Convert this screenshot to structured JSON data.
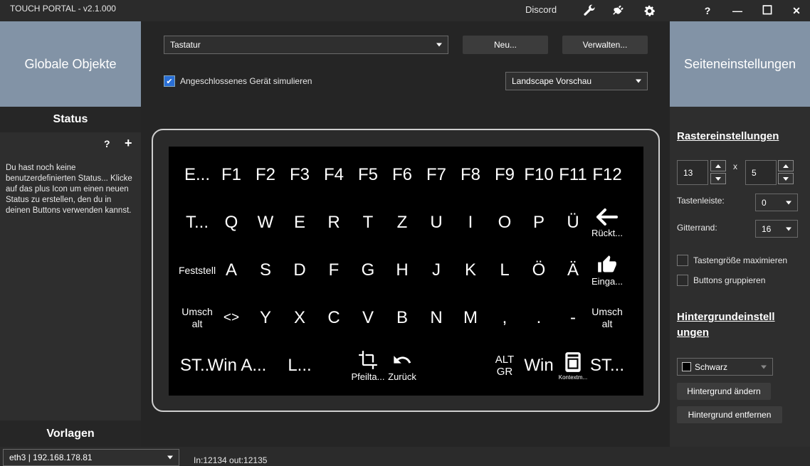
{
  "titlebar": {
    "app_title": "TOUCH PORTAL - v2.1.000",
    "profile": "Discord",
    "icons": [
      "wrench-icon",
      "plug-icon",
      "gear-icon"
    ],
    "help": "?",
    "minimize": "—",
    "maximize": "☐",
    "close": "✕"
  },
  "left": {
    "header": "Globale Objekte",
    "status_title": "Status",
    "status_help": "?",
    "status_add": "+",
    "status_text": "Du hast noch keine benutzerdefinierten Status... Klicke auf das plus Icon um einen neuen Status zu erstellen, den du in deinen Buttons verwenden kannst.",
    "templates_title": "Vorlagen"
  },
  "center": {
    "page_select": "Tastatur",
    "new_button": "Neu...",
    "manage_button": "Verwalten...",
    "simulate_checkbox": {
      "label": "Angeschlossenes Gerät simulieren",
      "checked": true
    },
    "preview_select": "Landscape Vorschau"
  },
  "keyboard": {
    "rows": [
      [
        "E...",
        "F1",
        "F2",
        "F3",
        "F4",
        "F5",
        "F6",
        "F7",
        "F8",
        "F9",
        "F10",
        "F11",
        "F12"
      ],
      [
        "T...",
        "Q",
        "W",
        "E",
        "R",
        "T",
        "Z",
        "U",
        "I",
        "O",
        "P",
        "Ü",
        "Rückt..."
      ],
      [
        "Feststell",
        "A",
        "S",
        "D",
        "F",
        "G",
        "H",
        "J",
        "K",
        "L",
        "Ö",
        "Ä",
        "Einga..."
      ],
      [
        "Umsch alt",
        "<>",
        "Y",
        "X",
        "C",
        "V",
        "B",
        "N",
        "M",
        ",",
        ".",
        "-",
        "Umsch alt"
      ],
      [
        "ST...",
        "Win A...",
        "L...",
        "",
        "",
        "Pfeilta...",
        "Zurück",
        "",
        "",
        "ALT GR",
        "Win",
        "Kontextm...",
        "ST..."
      ]
    ],
    "icons": {
      "backspace": "arrow-left-icon",
      "enter": "thumbs-up-icon",
      "arrows": "crop-icon",
      "back": "undo-icon",
      "context": "context-menu-icon"
    }
  },
  "right": {
    "header": "Seiteneinstellungen",
    "grid_title": "Rastereinstellungen",
    "cols": "13",
    "times": "x",
    "rows": "5",
    "toolbar_label": "Tastenleiste:",
    "toolbar_value": "0",
    "border_label": "Gitterrand:",
    "border_value": "16",
    "maximize_label": "Tastengröße maximieren",
    "group_label": "Buttons gruppieren",
    "bg_title": "Hintergrundeinstellungen",
    "bg_title_line1": "Hintergrundeinstell",
    "bg_title_line2": "ungen",
    "bg_color": "Schwarz",
    "bg_change": "Hintergrund ändern",
    "bg_remove": "Hintergrund entfernen"
  },
  "statusbar": {
    "network": "eth3 | 192.168.178.81",
    "connection": "In:12134 out:12135"
  },
  "colors": {
    "header_bg": "#8293a6",
    "accent": "#2a6fd6",
    "screen_bg": "#000000"
  }
}
